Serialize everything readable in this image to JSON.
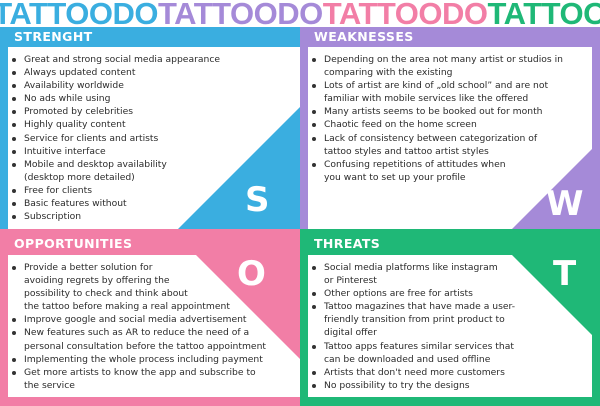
{
  "banner": {
    "words": [
      {
        "text": "TATTOODO",
        "color": "#3aaee0"
      },
      {
        "text": "TATTOODO",
        "color": "#a58ad8"
      },
      {
        "text": "TATTOODO",
        "color": "#f27ea6"
      },
      {
        "text": "TATTOO",
        "color": "#1fb877"
      }
    ]
  },
  "strength": {
    "title": "STRENGHT",
    "letter": "S",
    "color": "#3aaee0",
    "items": [
      {
        "text": "Great and strong social media appearance",
        "cont": false
      },
      {
        "text": "Always updated content",
        "cont": false
      },
      {
        "text": "Availability worldwide",
        "cont": false
      },
      {
        "text": "No ads while using",
        "cont": false
      },
      {
        "text": "Promoted by celebrities",
        "cont": false
      },
      {
        "text": "Highly quality content",
        "cont": false
      },
      {
        "text": "Service for clients and artists",
        "cont": false
      },
      {
        "text": "Intuitive interface",
        "cont": false
      },
      {
        "text": "Mobile and desktop availability",
        "cont": false
      },
      {
        "text": "(desktop more detailed)",
        "cont": true
      },
      {
        "text": "Free for clients",
        "cont": false
      },
      {
        "text": "Basic features without",
        "cont": false
      },
      {
        "text": "Subscription",
        "cont": false
      }
    ]
  },
  "weaknesses": {
    "title": "WEAKNESSES",
    "letter": "W",
    "color": "#a58ad8",
    "items": [
      {
        "text": "Depending on the area not many artist or studios in",
        "cont": false
      },
      {
        "text": "comparing with the existing",
        "cont": true
      },
      {
        "text": "Lots of artist are kind of „old school” and are not",
        "cont": false
      },
      {
        "text": "familiar with mobile services like the offered",
        "cont": true
      },
      {
        "text": "Many artists seems to be booked out for month",
        "cont": false
      },
      {
        "text": "Chaotic feed on the home screen",
        "cont": false
      },
      {
        "text": "Lack of consistency between categorization of",
        "cont": false
      },
      {
        "text": "tattoo styles and tattoo artist styles",
        "cont": true
      },
      {
        "text": "Confusing repetitions of attitudes when",
        "cont": false
      },
      {
        "text": "you want to set up your profile",
        "cont": true
      }
    ]
  },
  "opportunities": {
    "title": "OPPORTUNITIES",
    "letter": "O",
    "color": "#f27ea6",
    "items": [
      {
        "text": "Provide a better solution for",
        "cont": false
      },
      {
        "text": "avoiding regrets by offering the",
        "cont": true
      },
      {
        "text": "possibility to check and think about",
        "cont": true
      },
      {
        "text": "the tattoo before making a real appointment",
        "cont": true
      },
      {
        "text": "Improve google and social media advertisement",
        "cont": false
      },
      {
        "text": "New features such as AR to reduce the need of a",
        "cont": false
      },
      {
        "text": "personal consultation before the tattoo appointment",
        "cont": true
      },
      {
        "text": "Implementing the whole process including payment",
        "cont": false
      },
      {
        "text": "Get more artists to know the app and subscribe to",
        "cont": false
      },
      {
        "text": "the service",
        "cont": true
      }
    ]
  },
  "threats": {
    "title": "THREATS",
    "letter": "T",
    "color": "#1fb877",
    "items": [
      {
        "text": "Social media platforms like instagram",
        "cont": false
      },
      {
        "text": "or Pinterest",
        "cont": true
      },
      {
        "text": "Other options are free for artists",
        "cont": false
      },
      {
        "text": "Tattoo magazines that have made a user-",
        "cont": false
      },
      {
        "text": "friendly transition from print product to",
        "cont": true
      },
      {
        "text": "digital offer",
        "cont": true
      },
      {
        "text": "Tattoo apps features similar services that",
        "cont": false
      },
      {
        "text": "can be downloaded and used offline",
        "cont": true
      },
      {
        "text": "Artists that don't need more customers",
        "cont": false
      },
      {
        "text": "No possibility to try the designs",
        "cont": false
      }
    ]
  }
}
